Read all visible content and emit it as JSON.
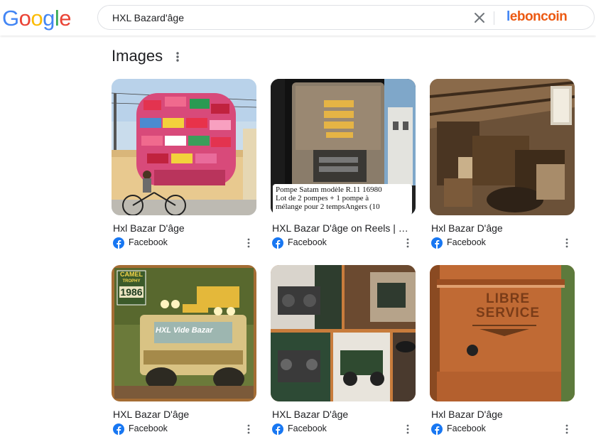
{
  "header": {
    "logo_letters": [
      {
        "char": "G",
        "color": "#4285f4"
      },
      {
        "char": "o",
        "color": "#ea4335"
      },
      {
        "char": "o",
        "color": "#fbbc05"
      },
      {
        "char": "g",
        "color": "#4285f4"
      },
      {
        "char": "l",
        "color": "#34a853"
      },
      {
        "char": "e",
        "color": "#ea4335"
      }
    ],
    "search_query": "HXL Bazard'âge",
    "partner_logo": "leboncoin",
    "clear_icon": "close-icon"
  },
  "section": {
    "title": "Images",
    "menu_icon": "more-vert-icon"
  },
  "results": [
    {
      "caption": "Hxl Bazar D'âge",
      "source": "Facebook",
      "thumb": "bicycle-crates"
    },
    {
      "caption": "HXL Bazar D'âge on Reels | Fa...",
      "source": "Facebook",
      "thumb": "fuel-pump",
      "overlay_lines": [
        "Pompe Satam modèle R.11 16980",
        "Lot de 2 pompes + 1 pompe à",
        "mélange pour 2 tempsAngers (10"
      ]
    },
    {
      "caption": "Hxl Bazar D'âge",
      "source": "Facebook",
      "thumb": "attic-junk"
    },
    {
      "caption": "HXL Bazar D'âge",
      "source": "Facebook",
      "thumb": "camel-trophy-poster",
      "overlay_lines": [
        "CAMEL",
        "TROPHY",
        "1986",
        "HXL Vide Bazar"
      ]
    },
    {
      "caption": "HXL Bazar D'âge",
      "source": "Facebook",
      "thumb": "jeep-furniture-collage"
    },
    {
      "caption": "Hxl Bazar D'âge",
      "source": "Facebook",
      "thumb": "libre-service-sign",
      "overlay_lines": [
        "LIBRE",
        "SERVICE"
      ]
    }
  ],
  "colors": {
    "facebook_blue": "#1877f2",
    "text": "#202124",
    "leboncoin_orange": "#ec5a13"
  }
}
